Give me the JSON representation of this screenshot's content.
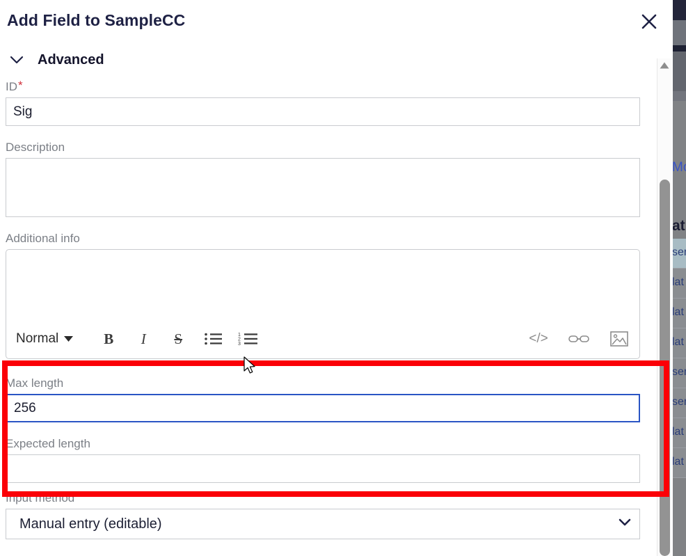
{
  "background": {
    "link_text": "Mo",
    "heading_text": "at",
    "table_rows": [
      {
        "text": "ser",
        "selected": true
      },
      {
        "text": "lat",
        "selected": false
      },
      {
        "text": "lat",
        "selected": false
      },
      {
        "text": "lat",
        "selected": false
      },
      {
        "text": "ser",
        "selected": false
      },
      {
        "text": "ser",
        "selected": false
      },
      {
        "text": "lat",
        "selected": false
      },
      {
        "text": "lat",
        "selected": false
      }
    ]
  },
  "dialog": {
    "title": "Add Field to SampleCC",
    "close_label": "✕",
    "section": {
      "label": "Advanced",
      "expanded": true
    },
    "fields": {
      "id": {
        "label": "ID",
        "required_marker": "*",
        "value": "Sig",
        "placeholder": ""
      },
      "description": {
        "label": "Description",
        "value": "",
        "placeholder": ""
      },
      "additional_info": {
        "label": "Additional info",
        "value": "",
        "placeholder": ""
      },
      "max_length": {
        "label": "Max length",
        "value": "256",
        "placeholder": "",
        "focused": true
      },
      "expected_length": {
        "label": "Expected length",
        "value": "",
        "placeholder": ""
      },
      "input_method": {
        "label": "Input method",
        "selected": "Manual entry (editable)",
        "options": [
          "Manual entry (editable)"
        ]
      }
    },
    "editor_toolbar": {
      "style_select": {
        "value": "Normal",
        "options": [
          "Normal"
        ]
      },
      "bold": "B",
      "italic": "I",
      "strikethrough": "S",
      "bullet_list": "bullet-list-icon",
      "numbered_list": "numbered-list-icon",
      "code_block": "</>",
      "link": "link-icon",
      "image": "image-icon"
    }
  },
  "scrollbar": {
    "up_arrow": "▲"
  },
  "annotation": {
    "color": "#fb0007",
    "shape": "rectangle"
  },
  "colors": {
    "title": "#1e2144",
    "label": "#7b7f86",
    "required": "#d0303a",
    "focus_border": "#2a55c4",
    "annotation": "#fb0007",
    "background_page": "#808285",
    "topbar": "#23253a"
  }
}
